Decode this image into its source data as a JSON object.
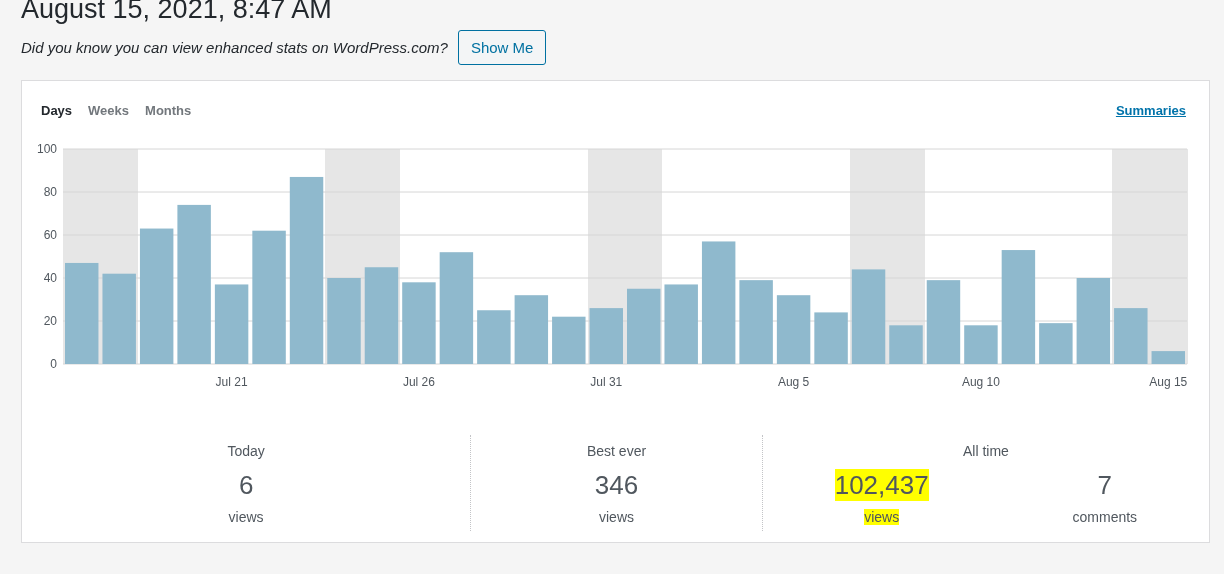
{
  "heading": "August 15, 2021, 8:47 AM",
  "notice": {
    "text": "Did you know you can view enhanced stats on WordPress.com?",
    "button": "Show Me"
  },
  "period_tabs": [
    {
      "label": "Days",
      "selected": true
    },
    {
      "label": "Weeks",
      "selected": false
    },
    {
      "label": "Months",
      "selected": false
    }
  ],
  "summaries_link": "Summaries",
  "chart_data": {
    "type": "bar",
    "categories": [
      null,
      null,
      null,
      null,
      "Jul 21",
      null,
      null,
      null,
      null,
      "Jul 26",
      null,
      null,
      null,
      null,
      "Jul 31",
      null,
      null,
      null,
      null,
      "Aug 5",
      null,
      null,
      null,
      null,
      "Aug 10",
      null,
      null,
      null,
      null,
      "Aug 15"
    ],
    "series": [
      {
        "color": "#8fb9cd",
        "values": [
          47,
          42,
          63,
          74,
          37,
          62,
          87,
          40,
          45,
          38,
          52,
          25,
          32,
          22,
          26,
          35,
          37,
          57,
          39,
          32,
          24,
          44,
          18,
          39,
          18,
          53,
          19,
          40,
          26,
          6
        ]
      }
    ],
    "ylim": [
      0,
      100
    ],
    "yticks": [
      0,
      20,
      40,
      60,
      80,
      100
    ],
    "grid": true,
    "orientation": "vertical"
  },
  "shaded_days": [
    true,
    true,
    false,
    false,
    false,
    false,
    false,
    true,
    true,
    false,
    false,
    false,
    false,
    false,
    true,
    true,
    false,
    false,
    false,
    false,
    false,
    true,
    true,
    false,
    false,
    false,
    false,
    false,
    true,
    true
  ],
  "stats": [
    {
      "title": "Today",
      "items": [
        {
          "value": "6",
          "unit": "views",
          "highlighted": false
        }
      ]
    },
    {
      "title": "Best ever",
      "items": [
        {
          "value": "346",
          "unit": "views",
          "highlighted": false
        }
      ]
    },
    {
      "title": "All time",
      "items": [
        {
          "value": "102,437",
          "unit": "views",
          "highlighted": true
        },
        {
          "value": "7",
          "unit": "comments",
          "highlighted": false
        }
      ]
    }
  ]
}
